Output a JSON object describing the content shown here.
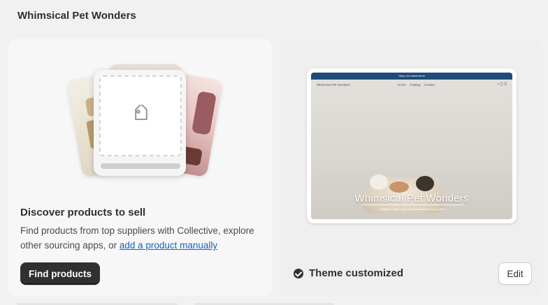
{
  "store": {
    "name": "Whimsical Pet Wonders"
  },
  "discover": {
    "heading": "Discover products to sell",
    "body_prefix": "Find products from top suppliers with Collective, explore other sourcing apps, or ",
    "link_text": "add a product manually",
    "button_label": "Find products"
  },
  "theme": {
    "preview": {
      "announcement": "Shop our latest items",
      "logo": "Whimsical Pet Wonders",
      "nav_links": [
        "Home",
        "Catalog",
        "Contact"
      ],
      "hero_title": "Whimsical Pet Wonders",
      "hero_subtitle": "Delightful, playful toys and accessories for your pets"
    },
    "status_label": "Theme customized",
    "edit_label": "Edit"
  },
  "icons": {
    "tag": "tag-icon",
    "check": "check-circle-icon"
  },
  "colors": {
    "primary_button": "#303030",
    "link": "#1f5fbf",
    "announcement_bar": "#1f4b78"
  }
}
